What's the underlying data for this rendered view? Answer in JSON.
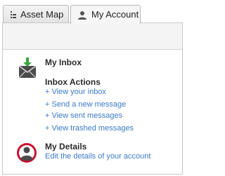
{
  "tabs": [
    {
      "label": "Asset Map",
      "icon": "asset-map-icon",
      "active": false
    },
    {
      "label": "My Account",
      "icon": "user-icon",
      "active": true
    }
  ],
  "inbox": {
    "title": "My Inbox",
    "icon": "inbox-envelope-icon",
    "actions_title": "Inbox Actions",
    "links": [
      "+ View your inbox",
      "+ Send a new message",
      "+ View sent messages",
      "+ View trashed messages"
    ]
  },
  "details": {
    "title": "My Details",
    "icon": "user-avatar-icon",
    "link": "Edit the details of your account"
  },
  "colors": {
    "link": "#3a7bc7",
    "avatar_red": "#c8102e",
    "arrow_green": "#3aa53a"
  }
}
